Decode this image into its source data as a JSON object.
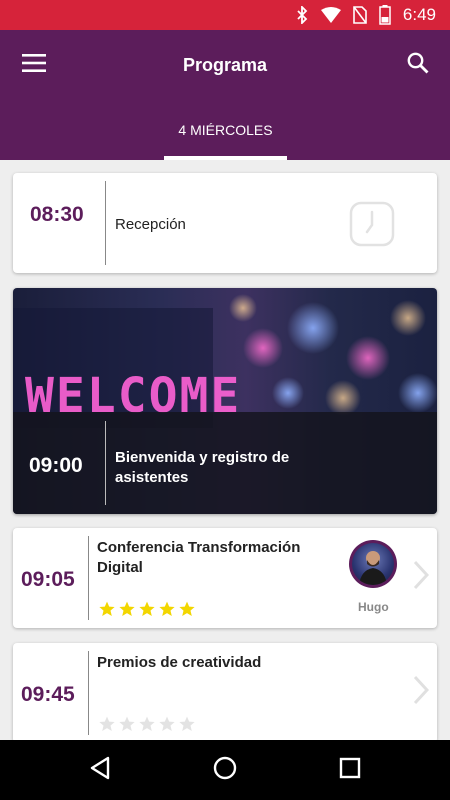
{
  "status_bar": {
    "time": "6:49"
  },
  "app_bar": {
    "title": "Programa"
  },
  "tabs": [
    {
      "label": "4 MIÉRCOLES",
      "active": true
    }
  ],
  "colors": {
    "primary": "#5c1d5b",
    "status_bar": "#d6233a",
    "star_on": "#f2d600",
    "star_off": "#e3e3e3"
  },
  "sessions": [
    {
      "time": "08:30",
      "title": "Recepción",
      "icon": "clock-icon"
    },
    {
      "time": "09:00",
      "title_line1": "Bienvenida y registro de",
      "title_line2": "asistentes",
      "image_text": "WELCOME"
    },
    {
      "time": "09:05",
      "title_line1": "Conferencia Transformación",
      "title_line2": "Digital",
      "rating": 5,
      "speaker": "Hugo"
    },
    {
      "time": "09:45",
      "title": "Premios de creatividad",
      "rating": 0
    }
  ]
}
